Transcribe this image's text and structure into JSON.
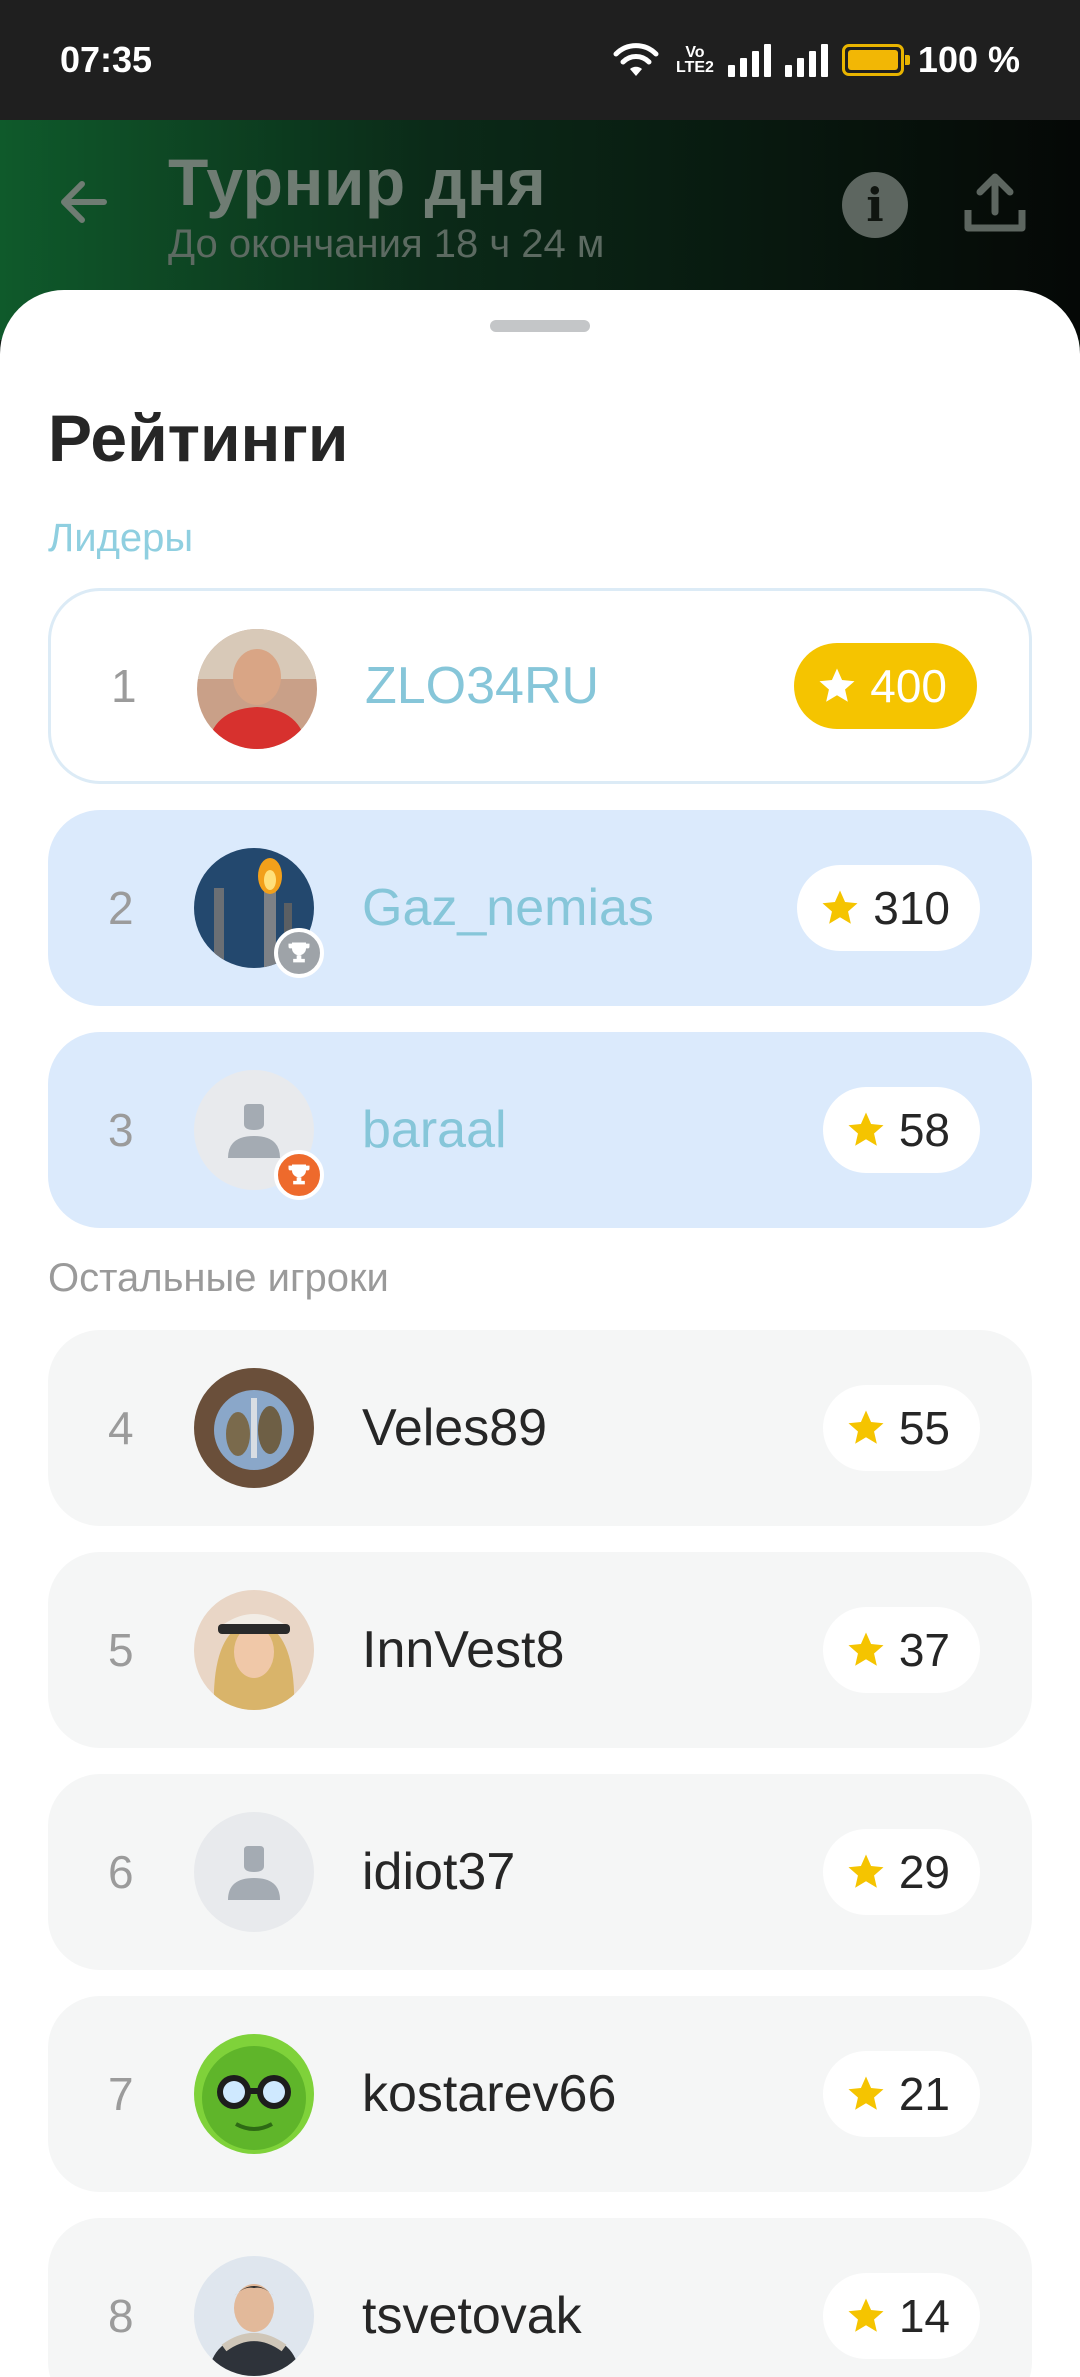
{
  "status_bar": {
    "time": "07:35",
    "network_top": "Vo",
    "network_bottom": "LTE2",
    "battery_percent": "100 %"
  },
  "header": {
    "title": "Турнир дня",
    "subtitle": "До окончания 18 ч 24 м"
  },
  "sheet": {
    "title": "Рейтинги",
    "leaders_label": "Лидеры",
    "others_label": "Остальные игроки"
  },
  "leaders": [
    {
      "rank": "1",
      "name": "ZLO34RU",
      "score": "400"
    },
    {
      "rank": "2",
      "name": "Gaz_nemias",
      "score": "310"
    },
    {
      "rank": "3",
      "name": "baraal",
      "score": "58"
    }
  ],
  "others": [
    {
      "rank": "4",
      "name": "Veles89",
      "score": "55"
    },
    {
      "rank": "5",
      "name": "InnVest8",
      "score": "37"
    },
    {
      "rank": "6",
      "name": "idiot37",
      "score": "29"
    },
    {
      "rank": "7",
      "name": "kostarev66",
      "score": "21"
    },
    {
      "rank": "8",
      "name": "tsvetovak",
      "score": "14"
    }
  ],
  "colors": {
    "accent_gold": "#f5c400",
    "leader_row": "#dbeafc",
    "leader_name": "#86c6d9",
    "silver_badge": "#9ea3a8",
    "bronze_badge": "#ee6a2c"
  }
}
